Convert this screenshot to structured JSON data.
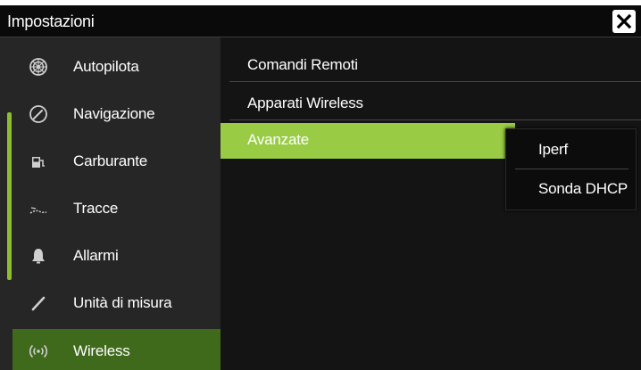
{
  "window": {
    "title": "Impostazioni",
    "close_icon": "close-x-icon"
  },
  "sidebar": {
    "items": [
      {
        "label": "Autopilota",
        "icon": "steering-wheel-icon",
        "active": false
      },
      {
        "label": "Navigazione",
        "icon": "compass-icon",
        "active": false
      },
      {
        "label": "Carburante",
        "icon": "fuel-pump-icon",
        "active": false
      },
      {
        "label": "Tracce",
        "icon": "track-icon",
        "active": false
      },
      {
        "label": "Allarmi",
        "icon": "bell-icon",
        "active": false
      },
      {
        "label": "Unità di misura",
        "icon": "ruler-pen-icon",
        "active": false
      },
      {
        "label": "Wireless",
        "icon": "wireless-icon",
        "active": true
      }
    ]
  },
  "menu": {
    "items": [
      {
        "label": "Comandi Remoti",
        "highlighted": false
      },
      {
        "label": "Apparati Wireless",
        "highlighted": false
      },
      {
        "label": "Avanzate",
        "highlighted": true
      }
    ]
  },
  "submenu": {
    "items": [
      {
        "label": "Iperf"
      },
      {
        "label": "Sonda DHCP"
      }
    ]
  },
  "colors": {
    "accent": "#99cc44",
    "active_sidebar": "#3f6a1c",
    "background": "#0a0a0a"
  }
}
